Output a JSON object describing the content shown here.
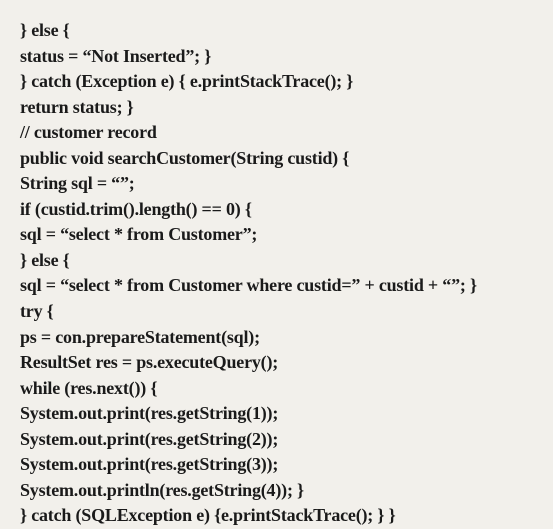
{
  "lines": {
    "l1": "} else {",
    "l2": "status = “Not Inserted”; }",
    "l3": "} catch (Exception e) { e.printStackTrace(); }",
    "l4": "return status; }",
    "l5": "// customer record",
    "l6": "public void searchCustomer(String custid) {",
    "l7": "String sql = “”;",
    "l8": "if (custid.trim().length() == 0) {",
    "l9": "sql = “select * from Customer”;",
    "l10": "} else {",
    "l11": "sql = “select * from Customer where custid=” + custid + “”; }",
    "l12": "try {",
    "l13": "ps = con.prepareStatement(sql);",
    "l14": "ResultSet res = ps.executeQuery();",
    "l15": "while (res.next()) {",
    "l16": "System.out.print(res.getString(1));",
    "l17": "System.out.print(res.getString(2));",
    "l18": "System.out.print(res.getString(3));",
    "l19": "System.out.println(res.getString(4)); }",
    "l20": "} catch (SQLException e) {e.printStackTrace(); } }"
  }
}
